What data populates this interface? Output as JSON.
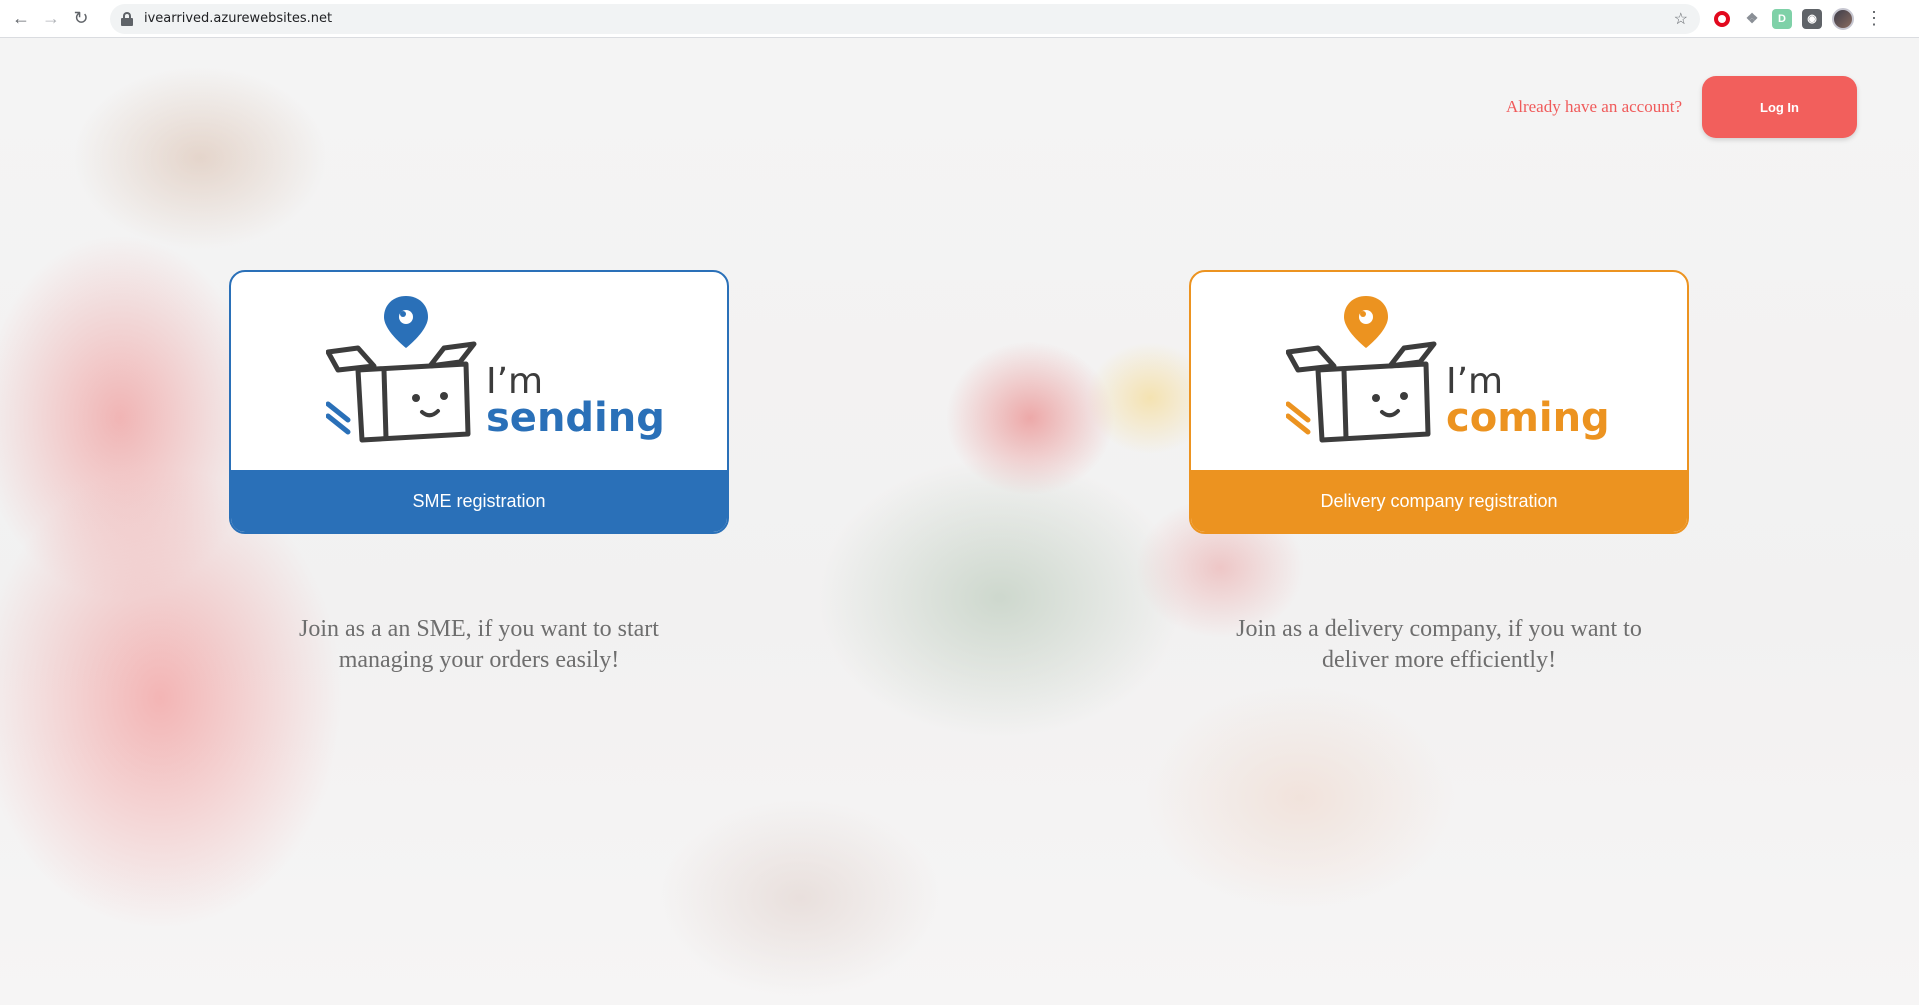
{
  "browser": {
    "url": "ivearrived.azurewebsites.net",
    "icons": [
      "back-icon",
      "forward-icon",
      "reload-icon",
      "lock-icon",
      "star-icon",
      "opera-icon",
      "dropbox-icon",
      "d-extension-icon",
      "shield-extension-icon",
      "avatar",
      "menu-icon"
    ]
  },
  "header": {
    "already_text": "Already have an account?",
    "login_label": "Log In"
  },
  "cards": {
    "sme": {
      "logo_im": "I’m",
      "logo_word": "sending",
      "button_label": "SME registration",
      "description": "Join as a an SME, if you want to start managing your orders easily!",
      "accent": "#2a70b8"
    },
    "delivery": {
      "logo_im": "I’m",
      "logo_word": "coming",
      "button_label": "Delivery company registration",
      "description": "Join as a delivery company, if you want to deliver more efficiently!",
      "accent": "#ec9320"
    }
  },
  "colors": {
    "login_button": "#f25f5c",
    "login_prompt": "#f05a5a"
  }
}
